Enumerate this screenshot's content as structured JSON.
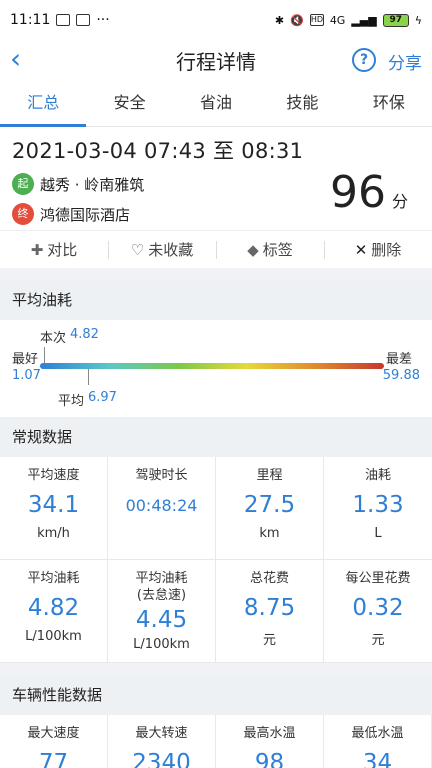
{
  "status": {
    "time": "11:11",
    "signal": "4G",
    "battery": "97"
  },
  "header": {
    "title": "行程详情",
    "help": "?",
    "share": "分享"
  },
  "tabs": [
    {
      "label": "汇总",
      "active": true
    },
    {
      "label": "安全"
    },
    {
      "label": "省油"
    },
    {
      "label": "技能"
    },
    {
      "label": "环保"
    }
  ],
  "trip": {
    "datetime": "2021-03-04 07:43 至 08:31",
    "start_badge": "起",
    "start": "越秀 · 岭南雅筑",
    "end_badge": "终",
    "end": "鸿德国际酒店",
    "score": "96",
    "score_unit": "分"
  },
  "actions": {
    "compare": "对比",
    "favorite": "未收藏",
    "tag": "标签",
    "delete": "删除"
  },
  "fuel": {
    "section": "平均油耗",
    "current_label": "本次",
    "current": "4.82",
    "best_label": "最好",
    "best": "1.07",
    "worst_label": "最差",
    "worst": "59.88",
    "avg_label": "平均",
    "avg": "6.97"
  },
  "regular": {
    "section": "常规数据",
    "cells": [
      {
        "name": "平均速度",
        "value": "34.1",
        "unit": "km/h"
      },
      {
        "name": "驾驶时长",
        "value": "00:48:24",
        "unit": ""
      },
      {
        "name": "里程",
        "value": "27.5",
        "unit": "km"
      },
      {
        "name": "油耗",
        "value": "1.33",
        "unit": "L"
      },
      {
        "name": "平均油耗",
        "value": "4.82",
        "unit": "L/100km"
      },
      {
        "name": "平均油耗",
        "name2": "(去怠速)",
        "value": "4.45",
        "unit": "L/100km"
      },
      {
        "name": "总花费",
        "value": "8.75",
        "unit": "元"
      },
      {
        "name": "每公里花费",
        "value": "0.32",
        "unit": "元"
      }
    ]
  },
  "performance": {
    "section": "车辆性能数据",
    "cells": [
      {
        "name": "最大速度",
        "value": "77"
      },
      {
        "name": "最大转速",
        "value": "2340"
      },
      {
        "name": "最高水温",
        "value": "98"
      },
      {
        "name": "最低水温",
        "value": "34"
      }
    ]
  }
}
